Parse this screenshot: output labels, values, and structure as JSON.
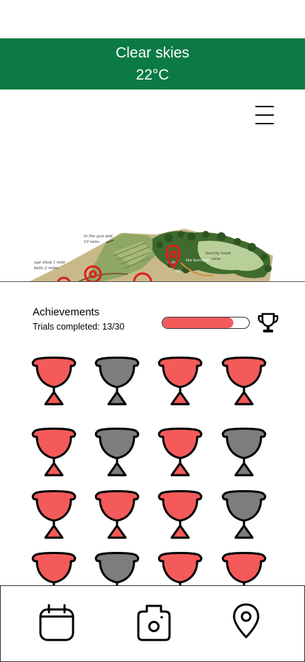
{
  "weather": {
    "condition": "Clear skies",
    "temperature": "22°C"
  },
  "menu": {
    "icon": "hamburger-menu-icon"
  },
  "map": {
    "labels": [
      "to the gun pad",
      "10 mins",
      "age shop 1 mile",
      "bells 2 miles",
      "the barrens",
      "beachy head",
      "view",
      "mile",
      "ild"
    ]
  },
  "achievements": {
    "title": "Achievements",
    "trials_text": "Trials completed: 13/30",
    "trials_completed": 13,
    "trials_total": 30,
    "progress_fraction": 0.82,
    "trophy_icon": "trophy-icon",
    "cup_states": [
      "earned",
      "locked",
      "earned",
      "earned",
      "earned",
      "locked",
      "earned",
      "locked",
      "earned",
      "earned",
      "earned",
      "locked",
      "earned",
      "locked",
      "earned",
      "earned"
    ]
  },
  "colors": {
    "header_green": "#0b7a45",
    "earned_red": "#f45a5a",
    "locked_gray": "#7d7d7d",
    "progress_red": "#f45a5a"
  },
  "bottom_nav": {
    "items": [
      {
        "icon": "calendar-icon"
      },
      {
        "icon": "camera-icon"
      },
      {
        "icon": "map-pin-icon"
      }
    ]
  }
}
